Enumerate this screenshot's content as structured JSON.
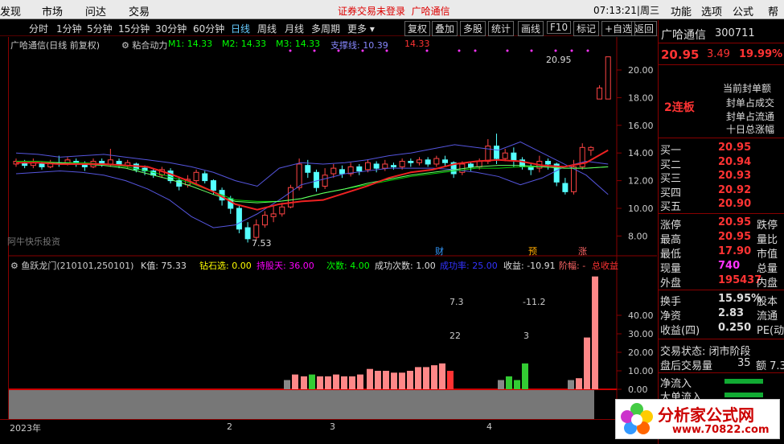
{
  "menu": {
    "items": [
      "发现",
      "市场",
      "问达",
      "交易"
    ],
    "notice": "证券交易未登录",
    "notice_stock": "广哈通信",
    "clock": "07:13:21",
    "weekday": "周三",
    "right_items": [
      "功能",
      "选项",
      "公式",
      "帮"
    ]
  },
  "toolbar": {
    "periods": [
      "分时",
      "1分钟",
      "5分钟",
      "15分钟",
      "30分钟",
      "60分钟",
      "日线",
      "周线",
      "月线",
      "多周期",
      "更多"
    ],
    "active": "日线",
    "buttons": [
      "复权",
      "叠加",
      "多股",
      "统计",
      "画线",
      "F10",
      "标记",
      "+自选",
      "返回"
    ]
  },
  "main_chart": {
    "title": "广哈通信(日线 前复权)",
    "indicator": "粘合动力",
    "m1": "M1: 14.33",
    "m2": "M2: 14.33",
    "m3": "M3: 14.33",
    "support": "支撑线: 10.39",
    "price_tag": "14.33",
    "y_ticks": [
      "20.00",
      "18.00",
      "16.00",
      "14.00",
      "12.00",
      "10.00",
      "8.00"
    ],
    "high_label": "20.95",
    "low_label": "7.53",
    "source": "阿牛快乐投资",
    "markers": [
      "财",
      "预",
      "涨"
    ]
  },
  "sub_chart": {
    "title": "鱼跃龙门(210101,250101)",
    "k_value": "K值: 75.33",
    "diamond": "钻石选: 0.00",
    "hold_days": "持股天: 36.00",
    "count": "次数: 4.00",
    "success": "成功次数: 1.00",
    "success_rate": "成功率: 25.00",
    "profit": "收益: -10.91",
    "amplitude": "阶幅: -",
    "total_profit": "总收益",
    "y_ticks": [
      "40.00",
      "30.00",
      "20.00",
      "10.00",
      "0.00"
    ],
    "annot_a": "7.3",
    "annot_b": "-11.2",
    "annot_c": "22",
    "annot_d": "3"
  },
  "timebar": {
    "labels": [
      "2023年",
      "2",
      "3",
      "4"
    ]
  },
  "quote": {
    "name": "广哈通信",
    "code": "300711",
    "price": "20.95",
    "change": "3.49",
    "pct": "19.99%",
    "board": "2连板",
    "notes": [
      "当前封单额",
      "封单占成交",
      "封单占流通",
      "十日总涨幅"
    ],
    "buys": [
      {
        "label": "买一",
        "price": "20.95"
      },
      {
        "label": "买二",
        "price": "20.94"
      },
      {
        "label": "买三",
        "price": "20.93"
      },
      {
        "label": "买四",
        "price": "20.92"
      },
      {
        "label": "买五",
        "price": "20.90"
      }
    ],
    "stats": [
      {
        "label": "涨停",
        "value": "20.95",
        "extra": "跌停"
      },
      {
        "label": "最高",
        "value": "20.95",
        "extra": "量比"
      },
      {
        "label": "最低",
        "value": "17.90",
        "extra": "市值"
      },
      {
        "label": "现量",
        "value": "740",
        "extra": "总量"
      },
      {
        "label": "外盘",
        "value": "195437",
        "extra": "内盘"
      }
    ],
    "stats2": [
      {
        "label": "换手",
        "value": "15.95%",
        "extra": "股本"
      },
      {
        "label": "净资",
        "value": "2.83",
        "extra": "流通"
      },
      {
        "label": "收益(四)",
        "value": "0.250",
        "extra": "PE(动)"
      }
    ],
    "trade_state": "交易状态: 闭市阶段",
    "after_hours": "盘后交易量",
    "after_vol": "35",
    "after_amt": "额 7.3",
    "net_in": "净流入",
    "big_in": "大单流入"
  },
  "watermark": {
    "text": "分析家公式网",
    "url": "www.70822.com"
  }
}
